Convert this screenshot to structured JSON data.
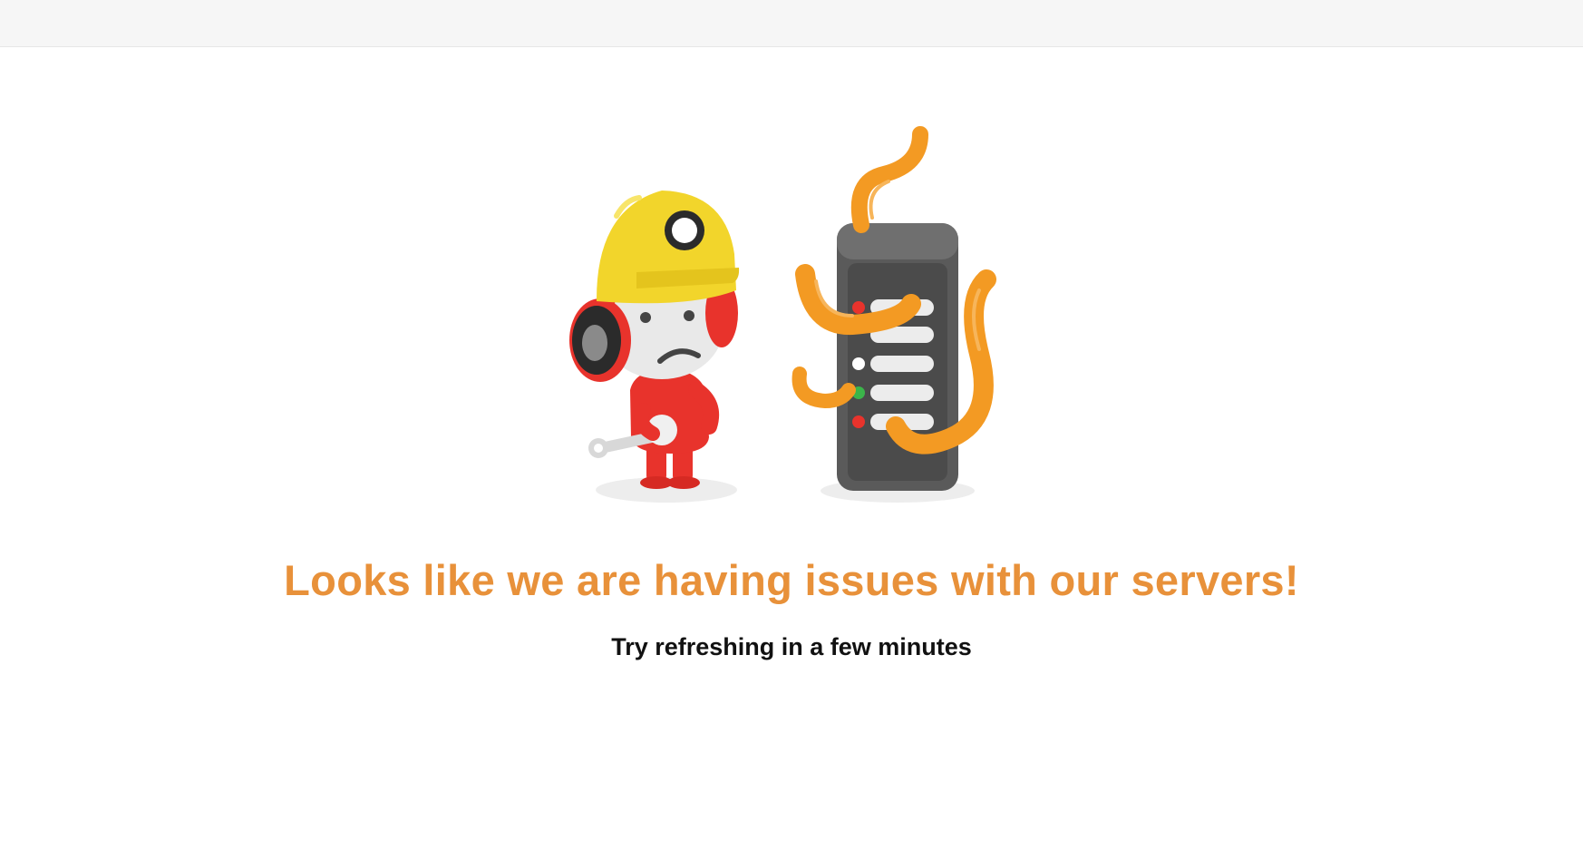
{
  "error": {
    "headline": "Looks like we are having issues with our servers!",
    "subtext": "Try refreshing in a few minutes"
  },
  "colors": {
    "headline": "#e8913a",
    "tentacle": "#f39a23",
    "mascot_body": "#e8332c",
    "helmet": "#f2d52b",
    "server": "#5a5a5a"
  },
  "illustration": {
    "mascot_icon": "snoo-construction-worker-icon",
    "server_icon": "server-rack-icon",
    "tentacles_icon": "tentacles-icon"
  }
}
